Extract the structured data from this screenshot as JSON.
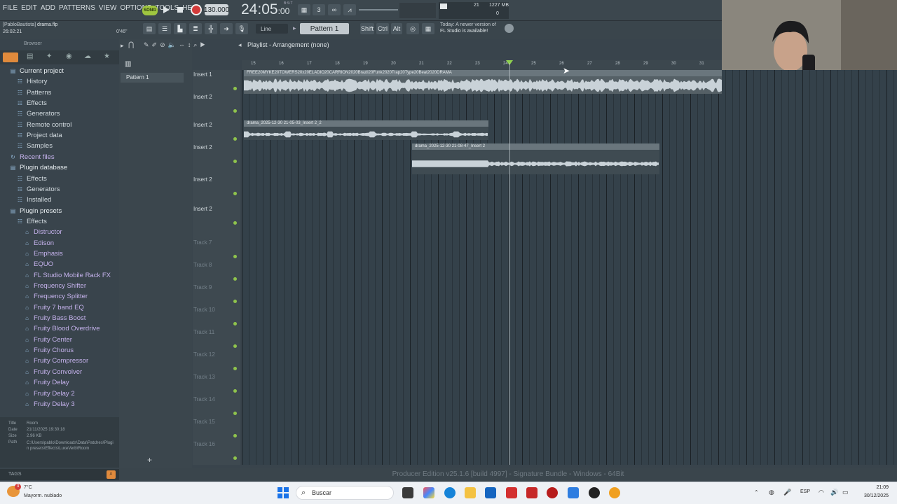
{
  "menu": [
    "FILE",
    "EDIT",
    "ADD",
    "PATTERNS",
    "VIEW",
    "OPTIONS",
    "TOOLS",
    "HELP"
  ],
  "transport": {
    "song_label": "SONG",
    "tempo": "130.000",
    "time": "24:05",
    "time_sub": ":00",
    "time_sup": "B:S:T"
  },
  "monitor": {
    "cpu": "21",
    "mem": "1227 MB",
    "voices": "0"
  },
  "project": {
    "info": "[PabloBautista]",
    "file": "drama.flp",
    "time": "26:02:21",
    "length": "0'46\""
  },
  "toolbar2": {
    "snap": "Line",
    "pattern": "Pattern 1",
    "shift": "Shift",
    "ctrl": "Ctrl",
    "alt": "Alt",
    "news_line1": "Today: A newer version of",
    "news_line2": "FL Studio is available!"
  },
  "browser": {
    "title": "Browser",
    "items": [
      {
        "label": "Current project",
        "type": "head"
      },
      {
        "label": "History",
        "type": "sub"
      },
      {
        "label": "Patterns",
        "type": "sub"
      },
      {
        "label": "Effects",
        "type": "sub"
      },
      {
        "label": "Generators",
        "type": "sub"
      },
      {
        "label": "Remote control",
        "type": "sub"
      },
      {
        "label": "Project data",
        "type": "sub"
      },
      {
        "label": "Samples",
        "type": "sub"
      },
      {
        "label": "Recent files",
        "type": "head2"
      },
      {
        "label": "Plugin database",
        "type": "head"
      },
      {
        "label": "Effects",
        "type": "sub"
      },
      {
        "label": "Generators",
        "type": "sub"
      },
      {
        "label": "Installed",
        "type": "sub"
      },
      {
        "label": "Plugin presets",
        "type": "head"
      },
      {
        "label": "Effects",
        "type": "sub"
      },
      {
        "label": "Distructor",
        "type": "leaf"
      },
      {
        "label": "Edison",
        "type": "leaf"
      },
      {
        "label": "Emphasis",
        "type": "leaf"
      },
      {
        "label": "EQUO",
        "type": "leaf"
      },
      {
        "label": "FL Studio Mobile Rack FX",
        "type": "leaf"
      },
      {
        "label": "Frequency Shifter",
        "type": "leaf"
      },
      {
        "label": "Frequency Splitter",
        "type": "leaf"
      },
      {
        "label": "Fruity 7 band EQ",
        "type": "leaf"
      },
      {
        "label": "Fruity Bass Boost",
        "type": "leaf"
      },
      {
        "label": "Fruity Blood Overdrive",
        "type": "leaf"
      },
      {
        "label": "Fruity Center",
        "type": "leaf"
      },
      {
        "label": "Fruity Chorus",
        "type": "leaf"
      },
      {
        "label": "Fruity Compressor",
        "type": "leaf"
      },
      {
        "label": "Fruity Convolver",
        "type": "leaf"
      },
      {
        "label": "Fruity Delay",
        "type": "leaf"
      },
      {
        "label": "Fruity Delay 2",
        "type": "leaf"
      },
      {
        "label": "Fruity Delay 3",
        "type": "leaf"
      }
    ],
    "fileinfo": {
      "title_k": "Title",
      "title_v": "Room",
      "date_k": "Date",
      "date_v": "21/11/2025 19:30:18",
      "size_k": "Size",
      "size_v": "2.96 KB",
      "path_k": "Path",
      "path_v": "C:\\Users\\pablo\\Downloads\\Data\\Patches\\Plugin presets\\Effects\\LuxeVerb\\Room"
    },
    "tags": "TAGS"
  },
  "playlist": {
    "title": "Playlist - Arrangement",
    "pattern": "(none)",
    "picker_item": "Pattern 1"
  },
  "ruler": [
    "15",
    "16",
    "17",
    "18",
    "19",
    "20",
    "21",
    "22",
    "23",
    "24",
    "25",
    "26",
    "27",
    "28",
    "29",
    "30",
    "31"
  ],
  "tracks": [
    {
      "name": "Insert 1",
      "dim": false
    },
    {
      "name": "Insert 2",
      "dim": false
    },
    {
      "name": "Insert 2",
      "dim": false
    },
    {
      "name": "Insert 2",
      "dim": false
    },
    {
      "name": "Insert 2",
      "dim": false
    },
    {
      "name": "Insert 2",
      "dim": false
    },
    {
      "name": "Track 7",
      "dim": true
    },
    {
      "name": "Track 8",
      "dim": true
    },
    {
      "name": "Track 9",
      "dim": true
    },
    {
      "name": "Track 10",
      "dim": true
    },
    {
      "name": "Track 11",
      "dim": true
    },
    {
      "name": "Track 12",
      "dim": true
    },
    {
      "name": "Track 13",
      "dim": true
    },
    {
      "name": "Track 14",
      "dim": true
    },
    {
      "name": "Track 15",
      "dim": true
    },
    {
      "name": "Track 16",
      "dim": true
    }
  ],
  "clips": [
    {
      "name": "FREE20MYKE20TOWERS20x20ELADIO20CARRION2020Brazil20Funk2020Trap20Type20Beat2020DRAMA"
    },
    {
      "name": "drama_2025-12-30 21-05-03_Insert 2_2"
    },
    {
      "name": "drama_2025-12-30 21-08-47_Insert 2"
    }
  ],
  "status": "Producer Edition v25.1.6 [build 4997] - Signature Bundle - Windows - 64Bit",
  "taskbar": {
    "temp": "7°C",
    "weather": "Mayorm. nublado",
    "search": "Buscar",
    "lang": "ESP",
    "time": "21:09",
    "date": "30/12/2025",
    "badge": "3"
  }
}
